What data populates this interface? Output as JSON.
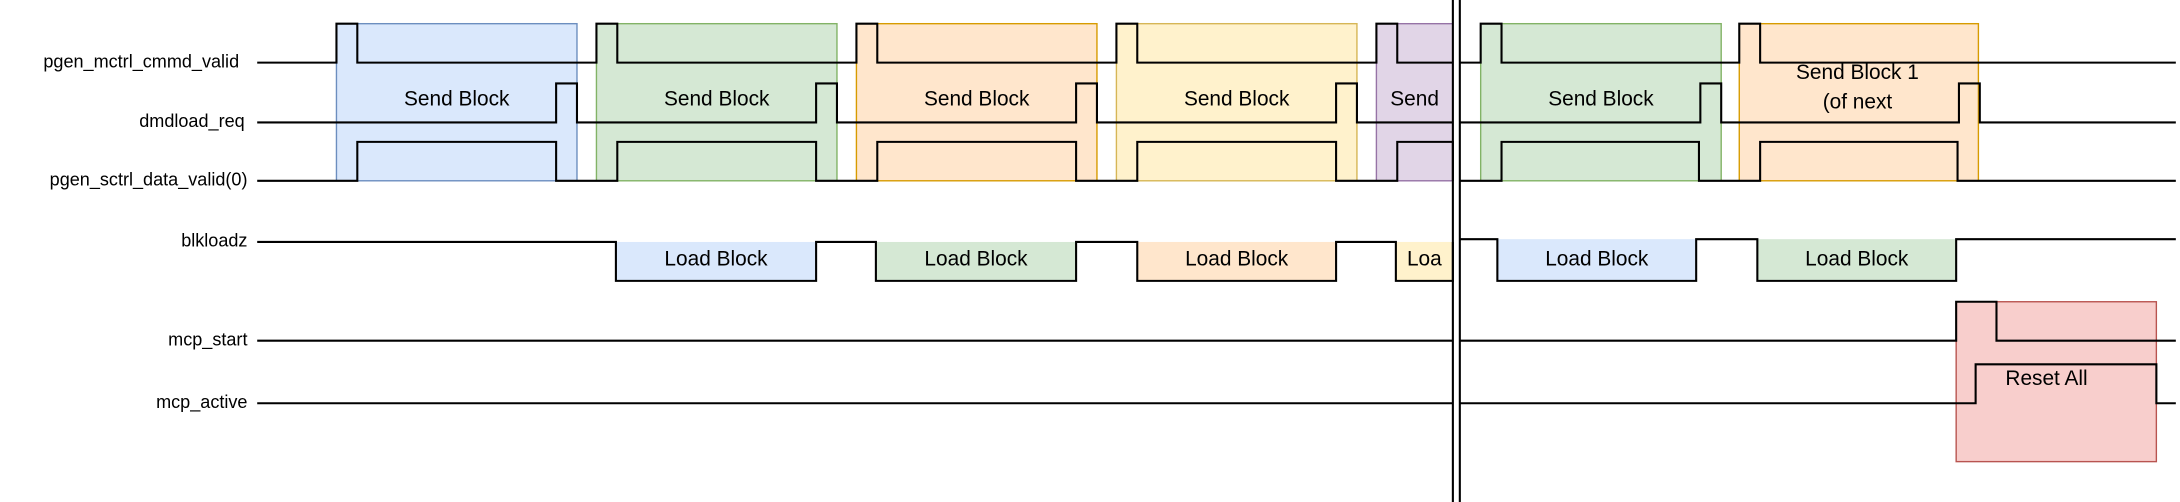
{
  "signals": [
    {
      "name": "pgen_mctrl_cmmd_valid"
    },
    {
      "name": "dmdload_req"
    },
    {
      "name": "pgen_sctrl_data_valid(0)"
    },
    {
      "name": "blkloadz"
    },
    {
      "name": "mcp_start"
    },
    {
      "name": "mcp_active"
    }
  ],
  "send_blocks": [
    {
      "label": "Send Block",
      "fill": "#dae8fc",
      "stroke": "#6c8ebf"
    },
    {
      "label": "Send Block",
      "fill": "#d5e8d4",
      "stroke": "#82b366"
    },
    {
      "label": "Send Block",
      "fill": "#ffe6cc",
      "stroke": "#d79b00"
    },
    {
      "label": "Send Block",
      "fill": "#fff2cc",
      "stroke": "#d6b656"
    },
    {
      "label": "Send",
      "fill": "#e1d5e7",
      "stroke": "#9673a6"
    },
    {
      "label": "Send Block",
      "fill": "#d5e8d4",
      "stroke": "#82b366"
    },
    {
      "label": "Send Block 1",
      "label2": "(of next",
      "fill": "#ffe6cc",
      "stroke": "#d79b00"
    }
  ],
  "load_blocks": [
    {
      "label": "Load Block",
      "fill": "#dae8fc"
    },
    {
      "label": "Load Block",
      "fill": "#d5e8d4"
    },
    {
      "label": "Load Block",
      "fill": "#ffe6cc"
    },
    {
      "label": "Loa",
      "fill": "#fff2cc"
    },
    {
      "label": "Load Block",
      "fill": "#dae8fc"
    },
    {
      "label": "Load Block",
      "fill": "#d5e8d4"
    }
  ],
  "reset_block": {
    "label": "Reset All",
    "fill": "#f8cecc",
    "stroke": "#b85450"
  }
}
